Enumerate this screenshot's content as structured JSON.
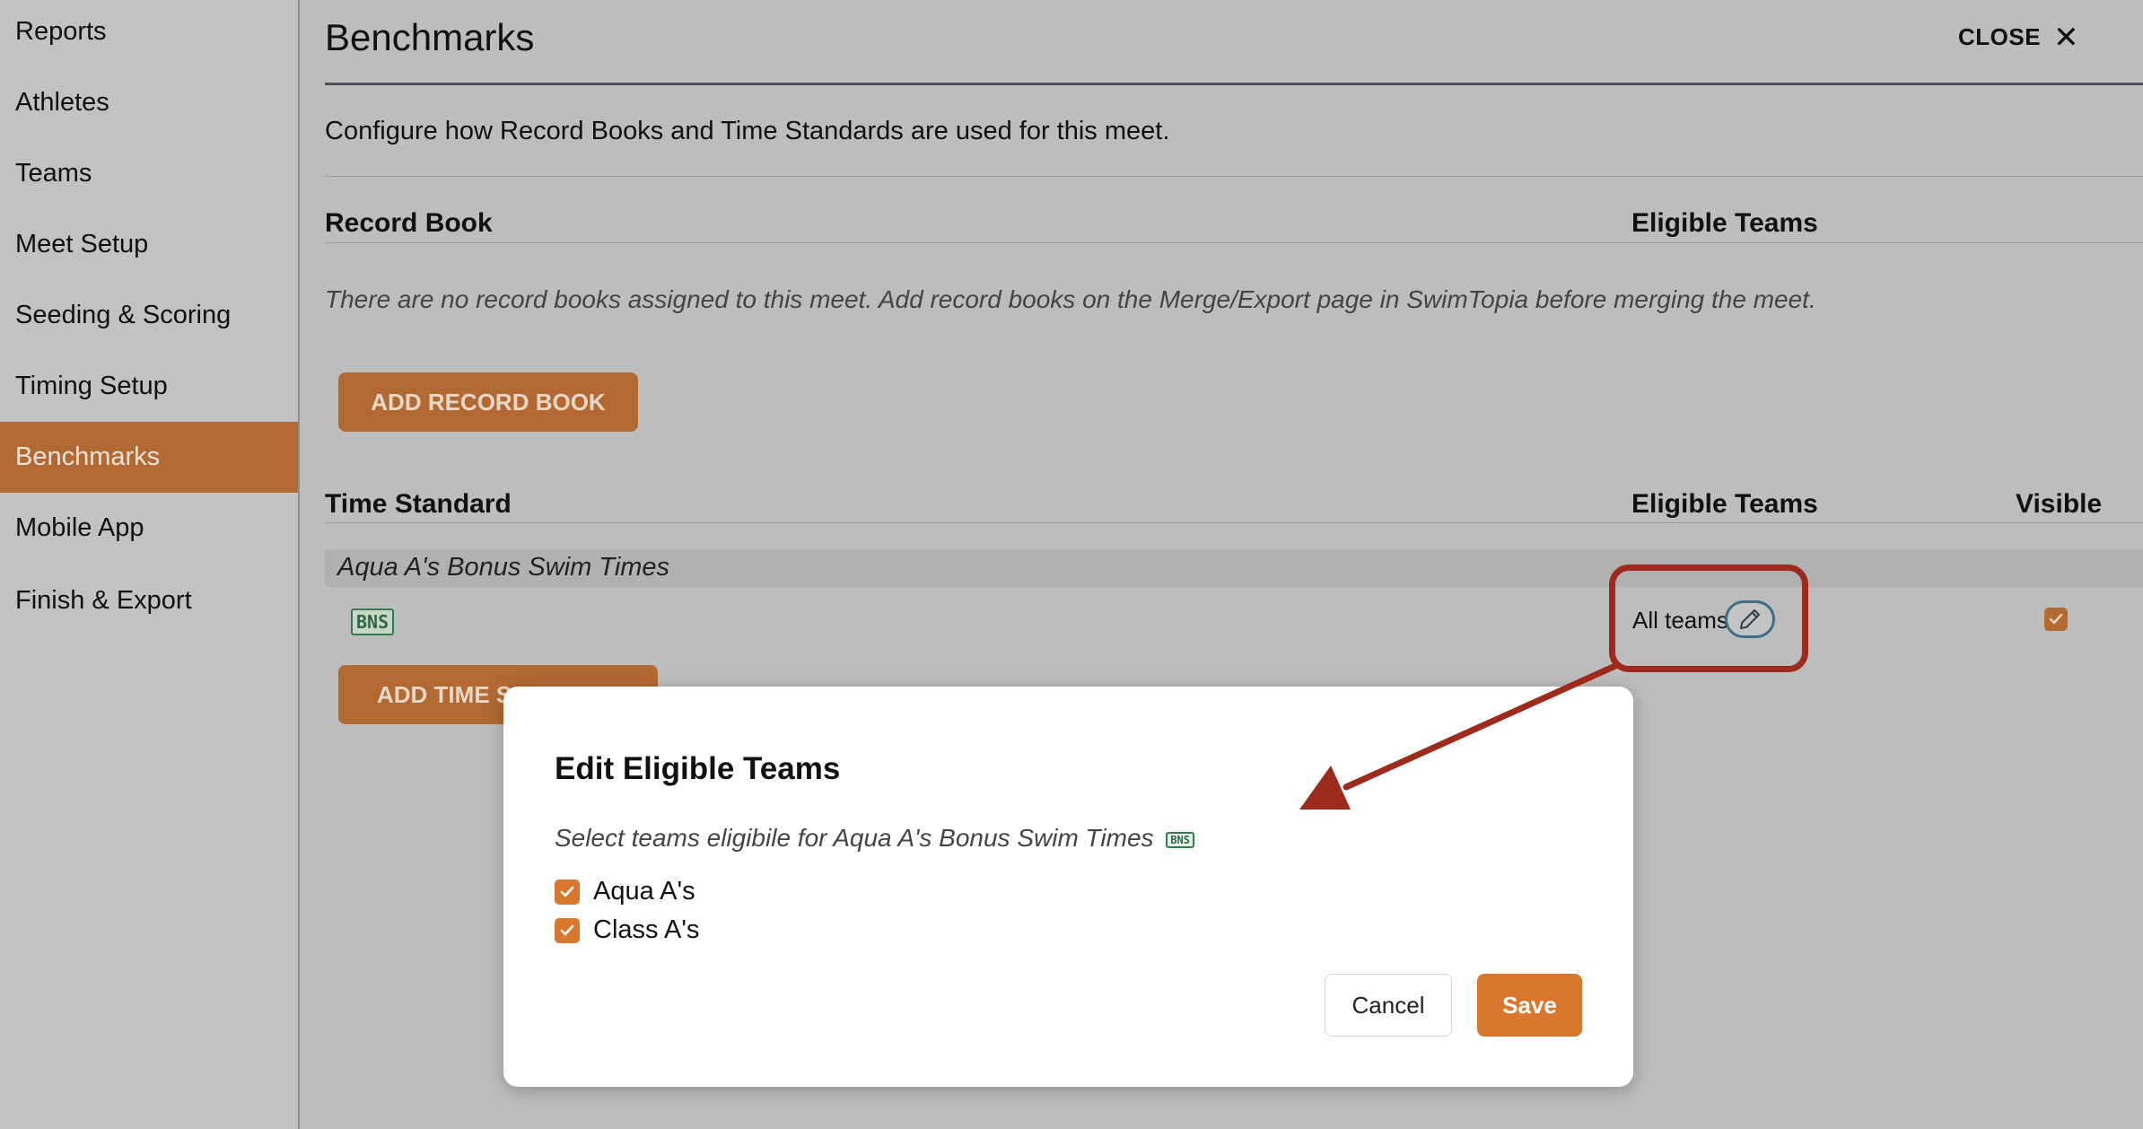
{
  "sidebar": {
    "items": [
      {
        "label": "Reports"
      },
      {
        "label": "Athletes"
      },
      {
        "label": "Teams"
      },
      {
        "label": "Meet Setup"
      },
      {
        "label": "Seeding & Scoring"
      },
      {
        "label": "Timing Setup"
      },
      {
        "label": "Benchmarks",
        "active": true
      },
      {
        "label": "Mobile App"
      },
      {
        "label": "Finish & Export"
      }
    ]
  },
  "header": {
    "title": "Benchmarks",
    "close_label": "CLOSE",
    "close_icon": "close-icon"
  },
  "main": {
    "description": "Configure how Record Books and Time Standards are used for this meet.",
    "record_book": {
      "col_record_book": "Record Book",
      "col_eligible_teams": "Eligible Teams",
      "empty_message": "There are no record books assigned to this meet. Add record books on the Merge/Export page in SwimTopia before merging the meet.",
      "add_button": "ADD RECORD BOOK"
    },
    "time_standard": {
      "col_time_standard": "Time Standard",
      "col_eligible_teams": "Eligible Teams",
      "col_visible": "Visible",
      "rows": [
        {
          "name": "Aqua A's Bonus Swim Times",
          "badge": "BNS",
          "eligible": "All teams",
          "visible": true
        }
      ],
      "add_button": "ADD TIME STANDARD",
      "add_button_visible": "ADD TIME S"
    }
  },
  "modal": {
    "title": "Edit Eligible Teams",
    "subtitle": "Select teams eligibile for Aqua A's Bonus Swim Times",
    "badge": "BNS",
    "teams": [
      {
        "label": "Aqua A's",
        "checked": true
      },
      {
        "label": "Class A's",
        "checked": true
      }
    ],
    "cancel_label": "Cancel",
    "save_label": "Save"
  },
  "colors": {
    "accent": "#d9772f",
    "annotation": "#9e2a1e",
    "badge_green": "#2e7d4f"
  }
}
